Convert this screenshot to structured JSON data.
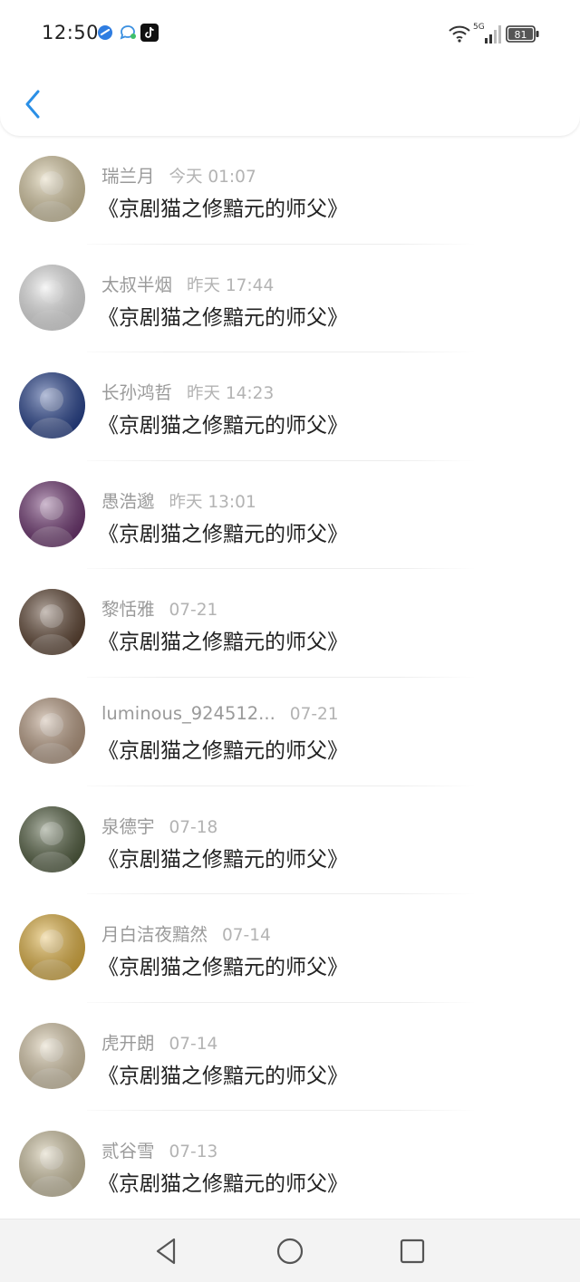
{
  "status_bar": {
    "time": "12:50",
    "battery": "81",
    "network": "5G",
    "icons": [
      "blue-app-icon",
      "chat-bubble-icon",
      "tiktok-icon"
    ]
  },
  "nav": {
    "back_icon": "chevron-left-icon",
    "accent": "#2a8fe6"
  },
  "items": [
    {
      "name": "瑞兰月",
      "time": "今天 01:07",
      "message": "《京剧猫之修黯元的师父》",
      "avatar_color": "#d8c9a0",
      "avatar_icon": "person-photo"
    },
    {
      "name": "太叔半烟",
      "time": "昨天 17:44",
      "message": "《京剧猫之修黯元的师父》",
      "avatar_color": "#e8e8e8",
      "avatar_icon": "anime-girl"
    },
    {
      "name": "长孙鸿哲",
      "time": "昨天 14:23",
      "message": "《京剧猫之修黯元的师父》",
      "avatar_color": "#1f3c8c",
      "avatar_icon": "blue-portrait"
    },
    {
      "name": "愚浩邈",
      "time": "昨天 13:01",
      "message": "《京剧猫之修黯元的师父》",
      "avatar_color": "#6b2f6e",
      "avatar_icon": "colorful-scene"
    },
    {
      "name": "黎恬雅",
      "time": "07-21",
      "message": "《京剧猫之修黯元的师父》",
      "avatar_color": "#5a3f2c",
      "avatar_icon": "face-photo"
    },
    {
      "name": "luminous_924512...",
      "time": "07-21",
      "message": "《京剧猫之修黯元的师父》",
      "avatar_color": "#b89a80",
      "avatar_icon": "cat-photo"
    },
    {
      "name": "泉德宇",
      "time": "07-18",
      "message": "《京剧猫之修黯元的师父》",
      "avatar_color": "#4d5a3a",
      "avatar_icon": "object-photo"
    },
    {
      "name": "月白洁夜黯然",
      "time": "07-14",
      "message": "《京剧猫之修黯元的师父》",
      "avatar_color": "#e3b23c",
      "avatar_icon": "cartoon-owl"
    },
    {
      "name": "虎开朗",
      "time": "07-14",
      "message": "《京剧猫之修黯元的师父》",
      "avatar_color": "#d9c9a8",
      "avatar_icon": "clock-basket"
    },
    {
      "name": "贰谷雪",
      "time": "07-13",
      "message": "《京剧猫之修黯元的师父》",
      "avatar_color": "#cfc3a0",
      "avatar_icon": "toy-figure"
    }
  ],
  "bottom_nav": {
    "back": "triangle-back-icon",
    "home": "circle-home-icon",
    "recent": "square-recent-icon"
  }
}
